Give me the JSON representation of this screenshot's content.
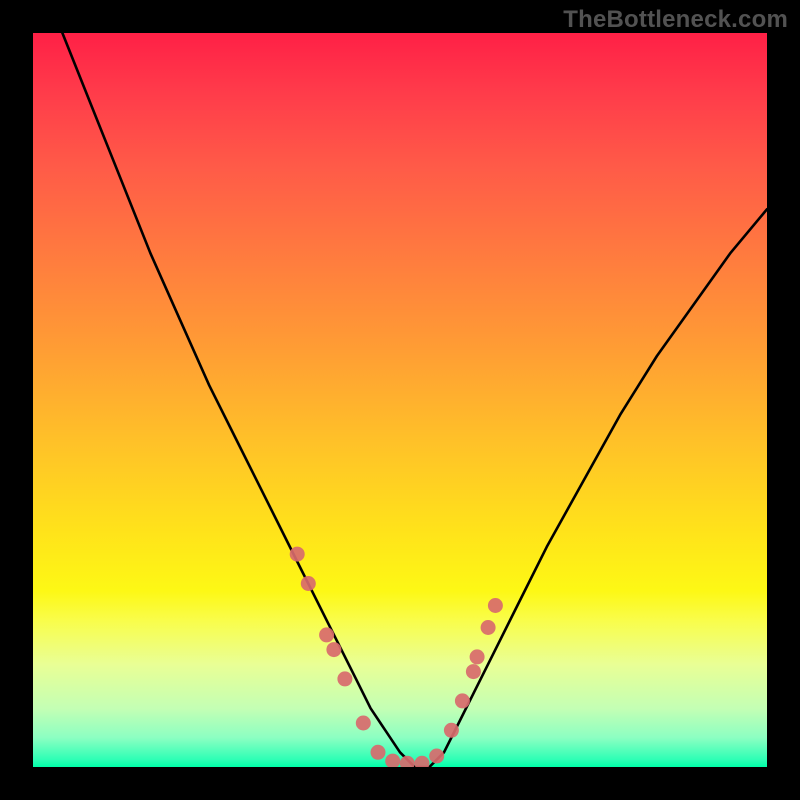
{
  "watermark": "TheBottleneck.com",
  "chart_data": {
    "type": "line",
    "title": "",
    "xlabel": "",
    "ylabel": "",
    "xlim": [
      0,
      100
    ],
    "ylim": [
      0,
      100
    ],
    "grid": false,
    "series": [
      {
        "name": "bottleneck-curve",
        "color": "#000000",
        "x": [
          4,
          8,
          12,
          16,
          20,
          24,
          28,
          32,
          36,
          38,
          40,
          42,
          44,
          46,
          48,
          50,
          52,
          54,
          56,
          58,
          60,
          62,
          66,
          70,
          75,
          80,
          85,
          90,
          95,
          100
        ],
        "y": [
          100,
          90,
          80,
          70,
          61,
          52,
          44,
          36,
          28,
          24,
          20,
          16,
          12,
          8,
          5,
          2,
          0,
          0,
          2,
          6,
          10,
          14,
          22,
          30,
          39,
          48,
          56,
          63,
          70,
          76
        ]
      }
    ],
    "points": {
      "name": "sample-dots",
      "color": "#d86a6d",
      "x": [
        36,
        37.5,
        40,
        41,
        42.5,
        45,
        47,
        49,
        51,
        53,
        55,
        57,
        58.5,
        60,
        60.5,
        62,
        63
      ],
      "y": [
        29,
        25,
        18,
        16,
        12,
        6,
        2,
        0.8,
        0.5,
        0.5,
        1.5,
        5,
        9,
        13,
        15,
        19,
        22
      ]
    },
    "background_gradient": {
      "orientation": "vertical",
      "stops": [
        {
          "pos": 0.0,
          "color": "#ff2046"
        },
        {
          "pos": 0.08,
          "color": "#ff3b4a"
        },
        {
          "pos": 0.18,
          "color": "#ff5a48"
        },
        {
          "pos": 0.3,
          "color": "#ff7a3f"
        },
        {
          "pos": 0.42,
          "color": "#ff9a35"
        },
        {
          "pos": 0.56,
          "color": "#ffc228"
        },
        {
          "pos": 0.68,
          "color": "#ffe31a"
        },
        {
          "pos": 0.76,
          "color": "#fdf815"
        },
        {
          "pos": 0.8,
          "color": "#f9fd4a"
        },
        {
          "pos": 0.86,
          "color": "#e9ff95"
        },
        {
          "pos": 0.92,
          "color": "#c4ffb4"
        },
        {
          "pos": 0.96,
          "color": "#8cffc2"
        },
        {
          "pos": 0.99,
          "color": "#2dffb5"
        },
        {
          "pos": 1.0,
          "color": "#00ffa9"
        }
      ]
    }
  }
}
